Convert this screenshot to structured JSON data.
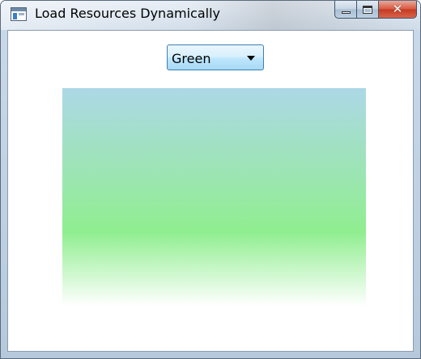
{
  "window": {
    "title": "Load Resources Dynamically",
    "icon": "app-window-icon",
    "caption_buttons": {
      "minimize": "minimize-icon",
      "maximize": "maximize-icon",
      "close": "close-icon",
      "close_glyph": "✕"
    }
  },
  "combo": {
    "selected": "Green",
    "icon": "chevron-down-icon"
  },
  "gradient": {
    "colors": [
      "#add8e6",
      "#90ee90",
      "#ffffff"
    ]
  }
}
